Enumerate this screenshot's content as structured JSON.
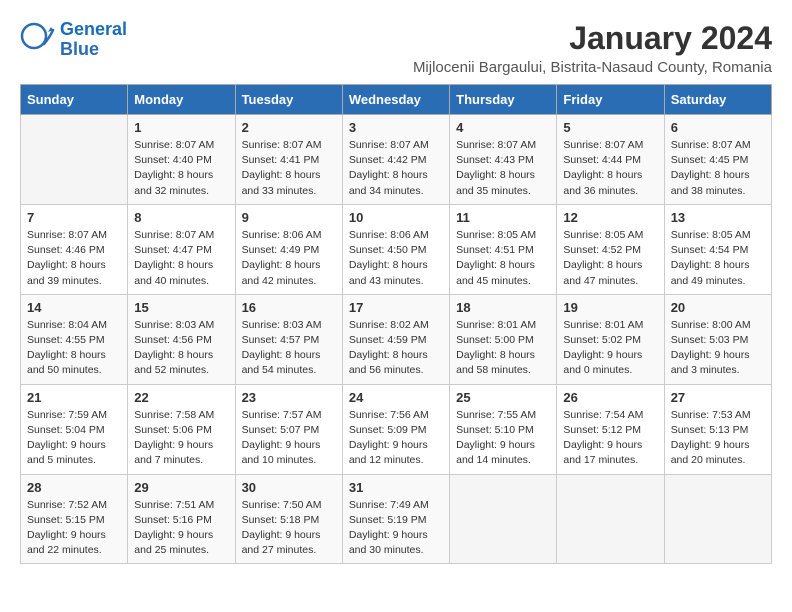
{
  "logo": {
    "line1": "General",
    "line2": "Blue"
  },
  "title": "January 2024",
  "location": "Mijlocenii Bargaului, Bistrita-Nasaud County, Romania",
  "days_of_week": [
    "Sunday",
    "Monday",
    "Tuesday",
    "Wednesday",
    "Thursday",
    "Friday",
    "Saturday"
  ],
  "weeks": [
    [
      {
        "day": "",
        "sunrise": "",
        "sunset": "",
        "daylight": "",
        "empty": true
      },
      {
        "day": "1",
        "sunrise": "Sunrise: 8:07 AM",
        "sunset": "Sunset: 4:40 PM",
        "daylight": "Daylight: 8 hours and 32 minutes."
      },
      {
        "day": "2",
        "sunrise": "Sunrise: 8:07 AM",
        "sunset": "Sunset: 4:41 PM",
        "daylight": "Daylight: 8 hours and 33 minutes."
      },
      {
        "day": "3",
        "sunrise": "Sunrise: 8:07 AM",
        "sunset": "Sunset: 4:42 PM",
        "daylight": "Daylight: 8 hours and 34 minutes."
      },
      {
        "day": "4",
        "sunrise": "Sunrise: 8:07 AM",
        "sunset": "Sunset: 4:43 PM",
        "daylight": "Daylight: 8 hours and 35 minutes."
      },
      {
        "day": "5",
        "sunrise": "Sunrise: 8:07 AM",
        "sunset": "Sunset: 4:44 PM",
        "daylight": "Daylight: 8 hours and 36 minutes."
      },
      {
        "day": "6",
        "sunrise": "Sunrise: 8:07 AM",
        "sunset": "Sunset: 4:45 PM",
        "daylight": "Daylight: 8 hours and 38 minutes."
      }
    ],
    [
      {
        "day": "7",
        "sunrise": "Sunrise: 8:07 AM",
        "sunset": "Sunset: 4:46 PM",
        "daylight": "Daylight: 8 hours and 39 minutes."
      },
      {
        "day": "8",
        "sunrise": "Sunrise: 8:07 AM",
        "sunset": "Sunset: 4:47 PM",
        "daylight": "Daylight: 8 hours and 40 minutes."
      },
      {
        "day": "9",
        "sunrise": "Sunrise: 8:06 AM",
        "sunset": "Sunset: 4:49 PM",
        "daylight": "Daylight: 8 hours and 42 minutes."
      },
      {
        "day": "10",
        "sunrise": "Sunrise: 8:06 AM",
        "sunset": "Sunset: 4:50 PM",
        "daylight": "Daylight: 8 hours and 43 minutes."
      },
      {
        "day": "11",
        "sunrise": "Sunrise: 8:05 AM",
        "sunset": "Sunset: 4:51 PM",
        "daylight": "Daylight: 8 hours and 45 minutes."
      },
      {
        "day": "12",
        "sunrise": "Sunrise: 8:05 AM",
        "sunset": "Sunset: 4:52 PM",
        "daylight": "Daylight: 8 hours and 47 minutes."
      },
      {
        "day": "13",
        "sunrise": "Sunrise: 8:05 AM",
        "sunset": "Sunset: 4:54 PM",
        "daylight": "Daylight: 8 hours and 49 minutes."
      }
    ],
    [
      {
        "day": "14",
        "sunrise": "Sunrise: 8:04 AM",
        "sunset": "Sunset: 4:55 PM",
        "daylight": "Daylight: 8 hours and 50 minutes."
      },
      {
        "day": "15",
        "sunrise": "Sunrise: 8:03 AM",
        "sunset": "Sunset: 4:56 PM",
        "daylight": "Daylight: 8 hours and 52 minutes."
      },
      {
        "day": "16",
        "sunrise": "Sunrise: 8:03 AM",
        "sunset": "Sunset: 4:57 PM",
        "daylight": "Daylight: 8 hours and 54 minutes."
      },
      {
        "day": "17",
        "sunrise": "Sunrise: 8:02 AM",
        "sunset": "Sunset: 4:59 PM",
        "daylight": "Daylight: 8 hours and 56 minutes."
      },
      {
        "day": "18",
        "sunrise": "Sunrise: 8:01 AM",
        "sunset": "Sunset: 5:00 PM",
        "daylight": "Daylight: 8 hours and 58 minutes."
      },
      {
        "day": "19",
        "sunrise": "Sunrise: 8:01 AM",
        "sunset": "Sunset: 5:02 PM",
        "daylight": "Daylight: 9 hours and 0 minutes."
      },
      {
        "day": "20",
        "sunrise": "Sunrise: 8:00 AM",
        "sunset": "Sunset: 5:03 PM",
        "daylight": "Daylight: 9 hours and 3 minutes."
      }
    ],
    [
      {
        "day": "21",
        "sunrise": "Sunrise: 7:59 AM",
        "sunset": "Sunset: 5:04 PM",
        "daylight": "Daylight: 9 hours and 5 minutes."
      },
      {
        "day": "22",
        "sunrise": "Sunrise: 7:58 AM",
        "sunset": "Sunset: 5:06 PM",
        "daylight": "Daylight: 9 hours and 7 minutes."
      },
      {
        "day": "23",
        "sunrise": "Sunrise: 7:57 AM",
        "sunset": "Sunset: 5:07 PM",
        "daylight": "Daylight: 9 hours and 10 minutes."
      },
      {
        "day": "24",
        "sunrise": "Sunrise: 7:56 AM",
        "sunset": "Sunset: 5:09 PM",
        "daylight": "Daylight: 9 hours and 12 minutes."
      },
      {
        "day": "25",
        "sunrise": "Sunrise: 7:55 AM",
        "sunset": "Sunset: 5:10 PM",
        "daylight": "Daylight: 9 hours and 14 minutes."
      },
      {
        "day": "26",
        "sunrise": "Sunrise: 7:54 AM",
        "sunset": "Sunset: 5:12 PM",
        "daylight": "Daylight: 9 hours and 17 minutes."
      },
      {
        "day": "27",
        "sunrise": "Sunrise: 7:53 AM",
        "sunset": "Sunset: 5:13 PM",
        "daylight": "Daylight: 9 hours and 20 minutes."
      }
    ],
    [
      {
        "day": "28",
        "sunrise": "Sunrise: 7:52 AM",
        "sunset": "Sunset: 5:15 PM",
        "daylight": "Daylight: 9 hours and 22 minutes."
      },
      {
        "day": "29",
        "sunrise": "Sunrise: 7:51 AM",
        "sunset": "Sunset: 5:16 PM",
        "daylight": "Daylight: 9 hours and 25 minutes."
      },
      {
        "day": "30",
        "sunrise": "Sunrise: 7:50 AM",
        "sunset": "Sunset: 5:18 PM",
        "daylight": "Daylight: 9 hours and 27 minutes."
      },
      {
        "day": "31",
        "sunrise": "Sunrise: 7:49 AM",
        "sunset": "Sunset: 5:19 PM",
        "daylight": "Daylight: 9 hours and 30 minutes."
      },
      {
        "day": "",
        "sunrise": "",
        "sunset": "",
        "daylight": "",
        "empty": true
      },
      {
        "day": "",
        "sunrise": "",
        "sunset": "",
        "daylight": "",
        "empty": true
      },
      {
        "day": "",
        "sunrise": "",
        "sunset": "",
        "daylight": "",
        "empty": true
      }
    ]
  ]
}
